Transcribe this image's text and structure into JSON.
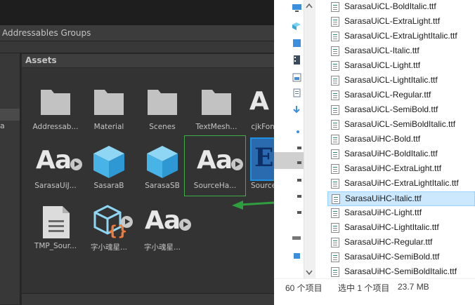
{
  "unity": {
    "window_title": "Addressables Groups",
    "left_panel_text": "a",
    "assets_header": "Assets",
    "assets": [
      {
        "label": "Addressab...",
        "icon": "folder-icon"
      },
      {
        "label": "Material",
        "icon": "folder-icon"
      },
      {
        "label": "Scenes",
        "icon": "folder-icon"
      },
      {
        "label": "TextMesh...",
        "icon": "folder-icon"
      },
      {
        "label": "cjkFont",
        "icon": "font-asset-icon",
        "glyph": "A"
      },
      {
        "label": "SarasaUiJ...",
        "icon": "font-asset-icon",
        "glyph": "Aa"
      },
      {
        "label": "SasaraB",
        "icon": "cube-prefab-icon"
      },
      {
        "label": "SarasaSB",
        "icon": "cube-prefab-icon"
      },
      {
        "label": "SourceHa...",
        "icon": "font-asset-icon",
        "glyph": "Aa"
      },
      {
        "label": "Source",
        "icon": "e-badge-icon",
        "glyph": "E"
      },
      {
        "label": "TMP_Sour...",
        "icon": "document-icon"
      },
      {
        "label": "字小魂星...",
        "icon": "script-cube-icon"
      },
      {
        "label": "字小魂星...",
        "icon": "font-asset-icon",
        "glyph": "Aa"
      }
    ]
  },
  "explorer": {
    "files": [
      "SarasaUiCL-BoldItalic.ttf",
      "SarasaUiCL-ExtraLight.ttf",
      "SarasaUiCL-ExtraLightItalic.ttf",
      "SarasaUiCL-Italic.ttf",
      "SarasaUiCL-Light.ttf",
      "SarasaUiCL-LightItalic.ttf",
      "SarasaUiCL-Regular.ttf",
      "SarasaUiCL-SemiBold.ttf",
      "SarasaUiCL-SemiBoldItalic.ttf",
      "SarasaUiHC-Bold.ttf",
      "SarasaUiHC-BoldItalic.ttf",
      "SarasaUiHC-ExtraLight.ttf",
      "SarasaUiHC-ExtraLightItalic.ttf",
      "SarasaUiHC-Italic.ttf",
      "SarasaUiHC-Light.ttf",
      "SarasaUiHC-LightItalic.ttf",
      "SarasaUiHC-Regular.ttf",
      "SarasaUiHC-SemiBold.ttf",
      "SarasaUiHC-SemiBoldItalic.ttf"
    ],
    "selected_file": "SarasaUiHC-Italic.ttf",
    "status_count": "60 个项目",
    "status_selected": "选中 1 个项目",
    "status_size": "23.7 MB"
  },
  "colors": {
    "unity_bg": "#282828",
    "selection_green": "#3fae4a",
    "explorer_selection": "#cce8ff",
    "accent_blue": "#1f8fe0"
  }
}
